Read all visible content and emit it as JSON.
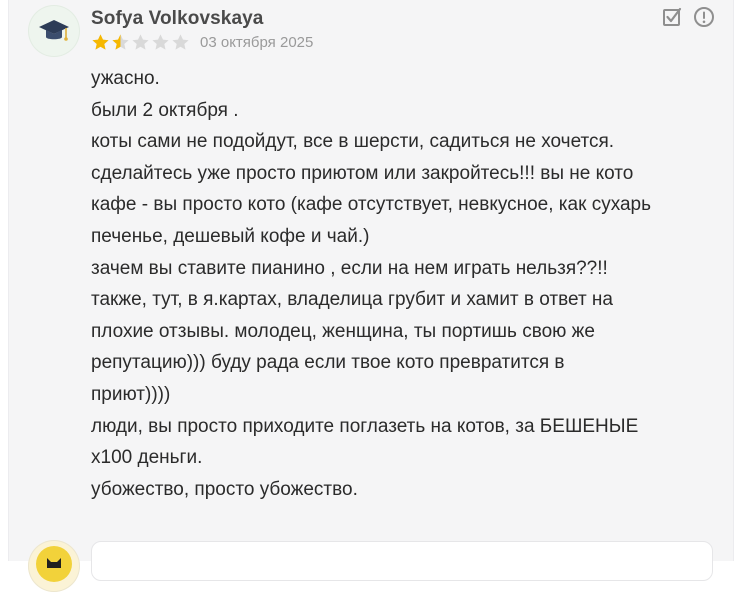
{
  "review": {
    "author": "Sofya Volkovskaya",
    "avatar_icon": "graduation-cap-icon",
    "rating": 1.5,
    "rating_max": 5,
    "date": "03 октября 2025",
    "actions": [
      {
        "icon": "edit-check-icon"
      },
      {
        "icon": "report-exclamation-icon"
      }
    ],
    "lines": [
      "ужасно.",
      "были 2 октября .",
      "коты сами не подойдут, все в шерсти, садиться не хочется.",
      "сделайтесь уже просто приютом или закройтесь!!! вы не кото",
      "кафе - вы просто кото (кафе отсутствует, невкусное, как сухарь",
      "печенье, дешевый кофе и чай.)",
      "зачем вы ставите пианино , если на нем играть нельзя??!!",
      "также, тут, в я.картах, владелица грубит и хамит в ответ на",
      "плохие отзывы. молодец, женщина, ты портишь свою же",
      "репутацию))) буду рада если твое кото превратится в",
      "приют))))",
      "люди, вы просто приходите поглазеть на котов, за БЕШЕНЫЕ",
      "х100 деньги.",
      "убожество, просто убожество."
    ]
  },
  "colors": {
    "star_filled": "#f6b800",
    "star_empty": "#d9d9d9",
    "icon_gray": "#8f8f8f",
    "card_bg": "#f5f5f6"
  },
  "reply": {
    "avatar_icon": "cat-avatar-icon",
    "input_value": ""
  }
}
